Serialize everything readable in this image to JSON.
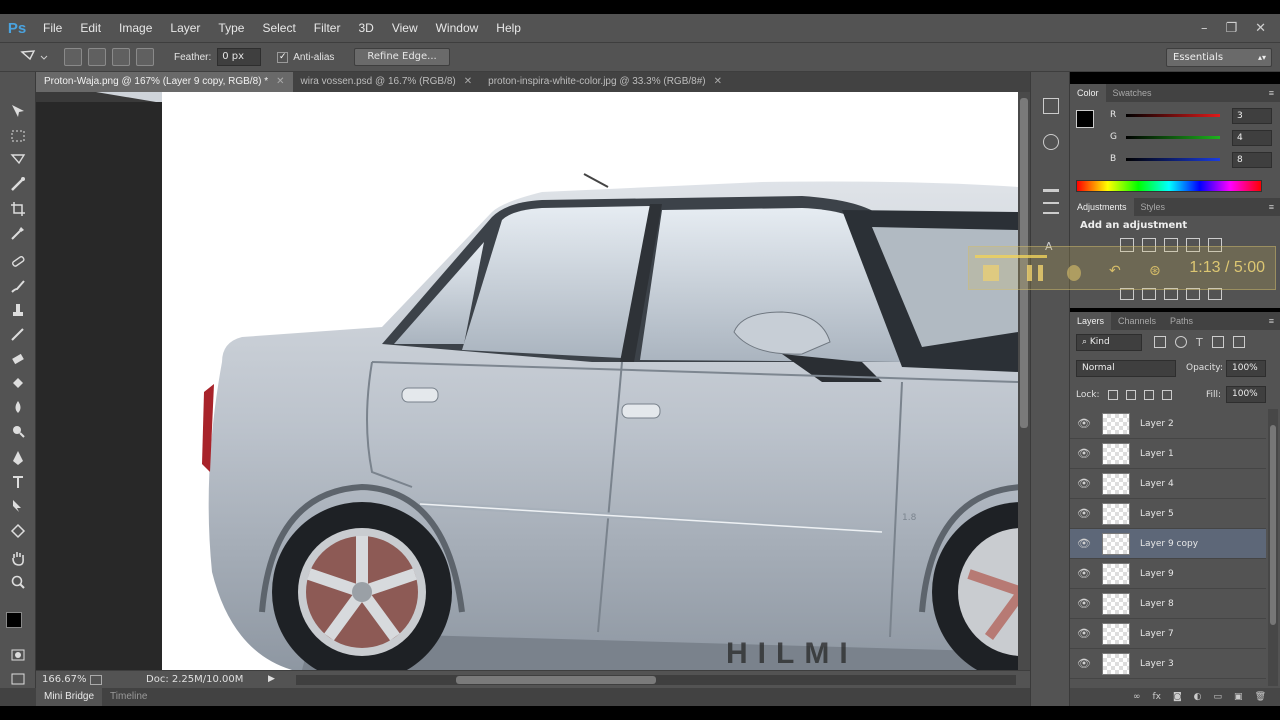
{
  "app": {
    "logo": "Ps"
  },
  "menu": [
    "File",
    "Edit",
    "Image",
    "Layer",
    "Type",
    "Select",
    "Filter",
    "3D",
    "View",
    "Window",
    "Help"
  ],
  "window_controls": [
    "–",
    "❐",
    "✕"
  ],
  "options": {
    "feather_label": "Feather:",
    "feather_value": "0 px",
    "antialias_label": "Anti-alias",
    "antialias_checked": true,
    "refine_button": "Refine Edge...",
    "workspace": "Essentials"
  },
  "tabs": [
    {
      "label": "Proton-Waja.png @ 167% (Layer 9 copy, RGB/8) *",
      "active": true
    },
    {
      "label": "wira vossen.psd @ 16.7% (RGB/8)",
      "active": false
    },
    {
      "label": "proton-inspira-white-color.jpg @ 33.3% (RGB/8#)",
      "active": false
    }
  ],
  "status": {
    "zoom": "166.67%",
    "doc": "Doc: 2.25M/10.00M"
  },
  "bottom_tabs": [
    "Mini Bridge",
    "Timeline"
  ],
  "watermark": "HILMI CONCEPT",
  "video": {
    "time": "1:13 / 5:00",
    "progress_fraction": 0.243
  },
  "color_panel": {
    "tabs": [
      "Color",
      "Swatches"
    ],
    "channels": [
      {
        "label": "R",
        "value": "3",
        "color": "#e01a1a"
      },
      {
        "label": "G",
        "value": "4",
        "color": "#1db31d"
      },
      {
        "label": "B",
        "value": "8",
        "color": "#1a3ce0"
      }
    ]
  },
  "adjustments_panel": {
    "tabs": [
      "Adjustments",
      "Styles"
    ],
    "heading": "Add an adjustment"
  },
  "layers_panel": {
    "tabs": [
      "Layers",
      "Channels",
      "Paths"
    ],
    "kind": "Kind",
    "blend_mode": "Normal",
    "opacity_label": "Opacity:",
    "opacity_value": "100%",
    "lock_label": "Lock:",
    "fill_label": "Fill:",
    "fill_value": "100%",
    "layers": [
      {
        "name": "Layer 2",
        "selected": false
      },
      {
        "name": "Layer 1",
        "selected": false
      },
      {
        "name": "Layer 4",
        "selected": false
      },
      {
        "name": "Layer 5",
        "selected": false
      },
      {
        "name": "Layer 9 copy",
        "selected": true
      },
      {
        "name": "Layer 9",
        "selected": false
      },
      {
        "name": "Layer 8",
        "selected": false
      },
      {
        "name": "Layer 7",
        "selected": false
      },
      {
        "name": "Layer 3",
        "selected": false
      }
    ]
  },
  "colors": {
    "panel_bg": "#535353",
    "selected_layer": "#5d6778",
    "ps_blue": "#4aa3df"
  }
}
